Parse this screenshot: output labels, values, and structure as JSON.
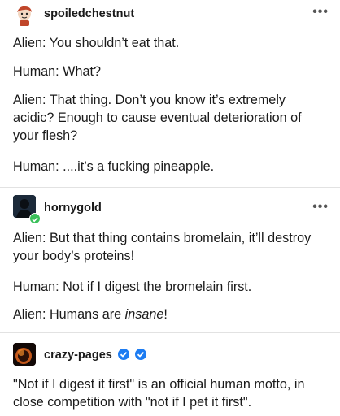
{
  "posts": [
    {
      "username": "spoiledchestnut",
      "more_menu": "•••",
      "paragraphs": [
        "Alien: You shouldn’t eat that.",
        "Human: What?",
        "Alien: That thing. Don’t you know it’s extremely acidic? Enough to cause eventual deterioration of your flesh?",
        "Human: ....it’s a fucking pineapple."
      ]
    },
    {
      "username": "hornygold",
      "more_menu": "•••",
      "paragraphs": [
        "Alien: But that thing contains bromelain, it’ll destroy your body’s proteins!",
        "Human: Not if I digest the bromelain first."
      ],
      "last_paragraph": {
        "prefix": "Alien: Humans are ",
        "emphasis": "insane",
        "suffix": "!"
      }
    },
    {
      "username": "crazy-pages",
      "paragraphs": [
        "\"Not if I digest it first\" is an official human motto, in close competition with \"not if I pet it first\"."
      ]
    }
  ],
  "colors": {
    "verified_badge": "#1d7cf2",
    "divider": "#e2e2e2",
    "text": "#1a1a1a",
    "hornygold_badge": "#3ac05a"
  }
}
